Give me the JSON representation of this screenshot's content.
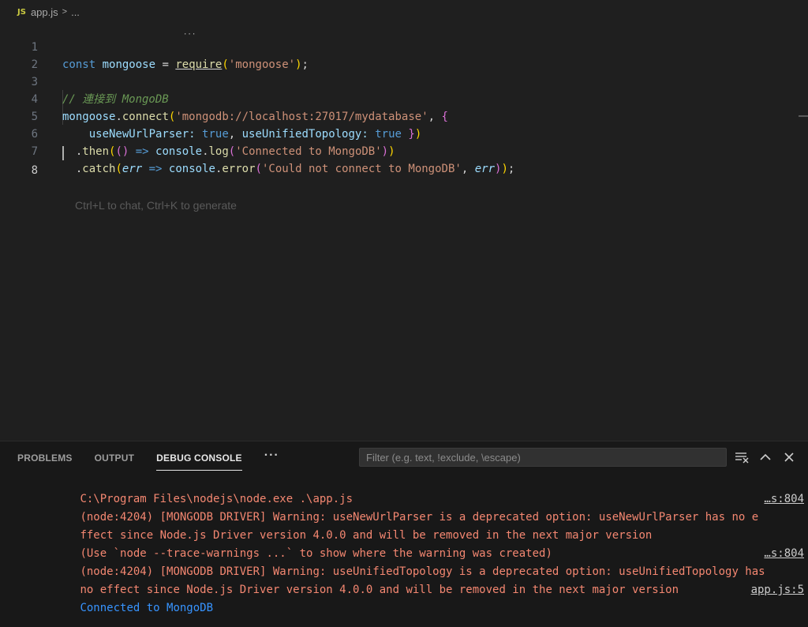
{
  "breadcrumb": {
    "file_icon": "JS",
    "file_name": "app.js",
    "separator": ">",
    "ellipsis": "..."
  },
  "editor": {
    "lines": [
      {
        "number": "1"
      },
      {
        "number": "2"
      },
      {
        "number": "3"
      },
      {
        "number": "4"
      },
      {
        "number": "5"
      },
      {
        "number": "6"
      },
      {
        "number": "7"
      },
      {
        "number": "8"
      }
    ],
    "tokens": {
      "l1": [
        "const",
        "mongoose",
        "=",
        "require",
        "(",
        "'mongoose'",
        ")",
        ";"
      ],
      "l3": "// 連接到 MongoDB",
      "l4": [
        "mongoose",
        ".",
        "connect",
        "(",
        "'mongodb://localhost:27017/mydatabase'",
        ",",
        "{"
      ],
      "l5": [
        "useNewUrlParser",
        ":",
        "true",
        ",",
        "useUnifiedTopology",
        ":",
        "true",
        "}",
        ")"
      ],
      "l6": [
        ".",
        "then",
        "(",
        "()",
        "=>",
        "console",
        ".",
        "log",
        "(",
        "'Connected to MongoDB'",
        ")",
        ")"
      ],
      "l7": [
        ".",
        "catch",
        "(",
        "err",
        "=>",
        "console",
        ".",
        "error",
        "(",
        "'Could not connect to MongoDB'",
        ",",
        "err",
        ")",
        ")",
        ";"
      ]
    },
    "ghost_hint": "Ctrl+L to chat, Ctrl+K to generate",
    "active_line": "8"
  },
  "panel": {
    "tabs": [
      {
        "label": "PROBLEMS",
        "active": false
      },
      {
        "label": "OUTPUT",
        "active": false
      },
      {
        "label": "DEBUG CONSOLE",
        "active": true
      }
    ],
    "more": "···",
    "filter_placeholder": "Filter (e.g. text, !exclude, \\escape)",
    "console": [
      {
        "text": "C:\\Program Files\\nodejs\\node.exe .\\app.js",
        "source": ""
      },
      {
        "text": "(node:4204) [MONGODB DRIVER] Warning: useNewUrlParser is a deprecated option: useNewUrlParser has no e",
        "source": "…s:804"
      },
      {
        "text": "ffect since Node.js Driver version 4.0.0 and will be removed in the next major version",
        "source": ""
      },
      {
        "text": "(Use `node --trace-warnings ...` to show where the warning was created)",
        "source": ""
      },
      {
        "text": "(node:4204) [MONGODB DRIVER] Warning: useUnifiedTopology is a deprecated option: useUnifiedTopology has",
        "source": "…s:804"
      },
      {
        "text": "no effect since Node.js Driver version 4.0.0 and will be removed in the next major version",
        "source": ""
      },
      {
        "text": "Connected to MongoDB",
        "source": "app.js:5"
      }
    ]
  },
  "colors": {
    "background": "#1f1f1f",
    "warning": "#f48771",
    "info": "#3794ff"
  }
}
